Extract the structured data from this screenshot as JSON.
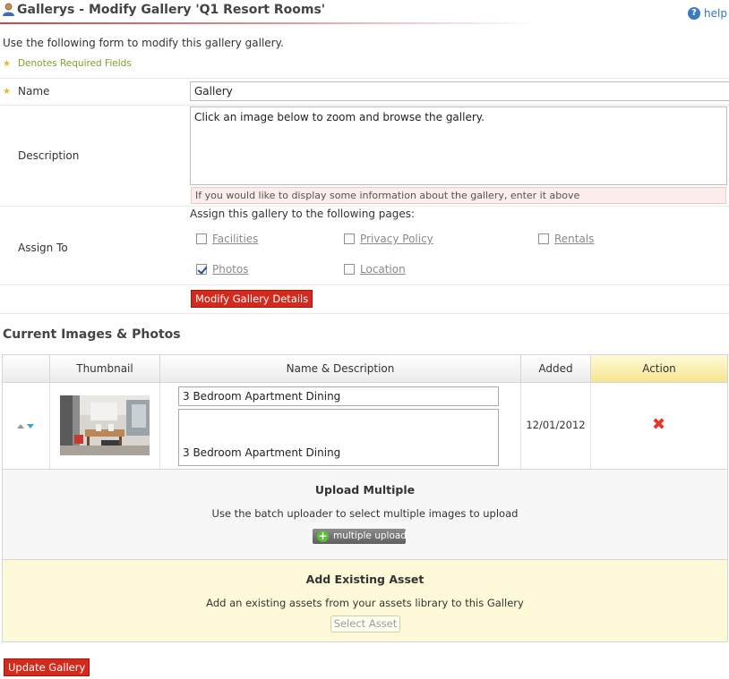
{
  "header": {
    "title": "Gallerys - Modify Gallery 'Q1 Resort Rooms'",
    "help_label": "help",
    "accent": "#c7474b"
  },
  "intro": "Use the following form to modify this gallery gallery.",
  "required_note": "Denotes Required Fields",
  "form": {
    "name_label": "Name",
    "name_value": "Gallery",
    "description_label": "Description",
    "description_value": "Click an image below to zoom and browse the gallery.",
    "description_hint": "If you would like to display some information about the gallery, enter it above",
    "assign_label": "Assign To",
    "assign_text": "Assign this gallery to the following pages:",
    "pages": [
      {
        "label": "Facilities",
        "checked": false
      },
      {
        "label": "Privacy Policy",
        "checked": false
      },
      {
        "label": "Rentals",
        "checked": false
      },
      {
        "label": "Photos",
        "checked": true
      },
      {
        "label": "Location",
        "checked": false
      }
    ],
    "modify_button": "Modify Gallery Details"
  },
  "images": {
    "section_title": "Current Images & Photos",
    "columns": [
      "Thumbnail",
      "Name & Description",
      "Added",
      "Action"
    ],
    "rows": [
      {
        "name": "3 Bedroom Apartment Dining",
        "description": "3 Bedroom Apartment Dining",
        "added": "12/01/2012",
        "action_icon": "delete-x-icon"
      }
    ]
  },
  "upload": {
    "title": "Upload Multiple",
    "text": "Use the batch uploader to select multiple images to upload",
    "button": "multiple upload"
  },
  "existing": {
    "title": "Add Existing Asset",
    "text": "Add an existing assets from your assets library to this Gallery",
    "button": "Select Asset"
  },
  "update_button": "Update Gallery",
  "colors": {
    "primary_button": "#d42a1e",
    "action_header": "#f5e58e",
    "existing_bg": "#fefad9",
    "hint_bg": "#fcecec"
  }
}
